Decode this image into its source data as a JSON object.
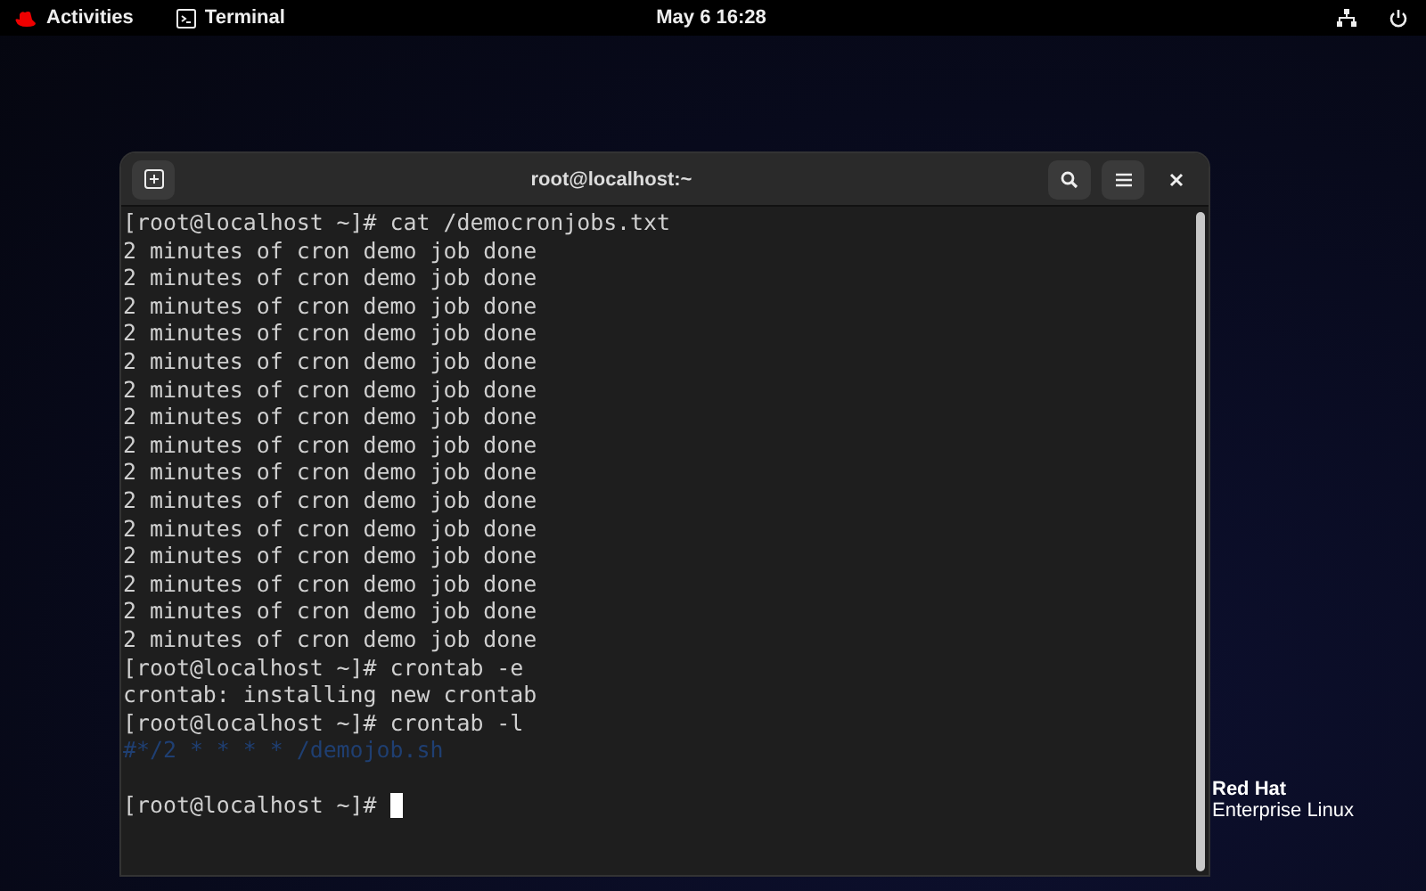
{
  "top_bar": {
    "activities": "Activities",
    "app": "Terminal",
    "clock": "May 6  16:28"
  },
  "window": {
    "title": "root@localhost:~"
  },
  "terminal": {
    "lines": [
      {
        "kind": "output",
        "text": "[root@localhost ~]# cat /democronjobs.txt"
      },
      {
        "kind": "output",
        "text": "2 minutes of cron demo job done"
      },
      {
        "kind": "output",
        "text": "2 minutes of cron demo job done"
      },
      {
        "kind": "output",
        "text": "2 minutes of cron demo job done"
      },
      {
        "kind": "output",
        "text": "2 minutes of cron demo job done"
      },
      {
        "kind": "output",
        "text": "2 minutes of cron demo job done"
      },
      {
        "kind": "output",
        "text": "2 minutes of cron demo job done"
      },
      {
        "kind": "output",
        "text": "2 minutes of cron demo job done"
      },
      {
        "kind": "output",
        "text": "2 minutes of cron demo job done"
      },
      {
        "kind": "output",
        "text": "2 minutes of cron demo job done"
      },
      {
        "kind": "output",
        "text": "2 minutes of cron demo job done"
      },
      {
        "kind": "output",
        "text": "2 minutes of cron demo job done"
      },
      {
        "kind": "output",
        "text": "2 minutes of cron demo job done"
      },
      {
        "kind": "output",
        "text": "2 minutes of cron demo job done"
      },
      {
        "kind": "output",
        "text": "2 minutes of cron demo job done"
      },
      {
        "kind": "output",
        "text": "2 minutes of cron demo job done"
      },
      {
        "kind": "output",
        "text": "[root@localhost ~]# crontab -e"
      },
      {
        "kind": "output",
        "text": "crontab: installing new crontab"
      },
      {
        "kind": "output",
        "text": "[root@localhost ~]# crontab -l"
      },
      {
        "kind": "comment",
        "text": "#*/2 * * * * /demojob.sh"
      },
      {
        "kind": "blank"
      },
      {
        "kind": "prompt",
        "text": "[root@localhost ~]# "
      }
    ]
  },
  "branding": {
    "line_1": "Red Hat",
    "line_2": "Enterprise Linux"
  }
}
